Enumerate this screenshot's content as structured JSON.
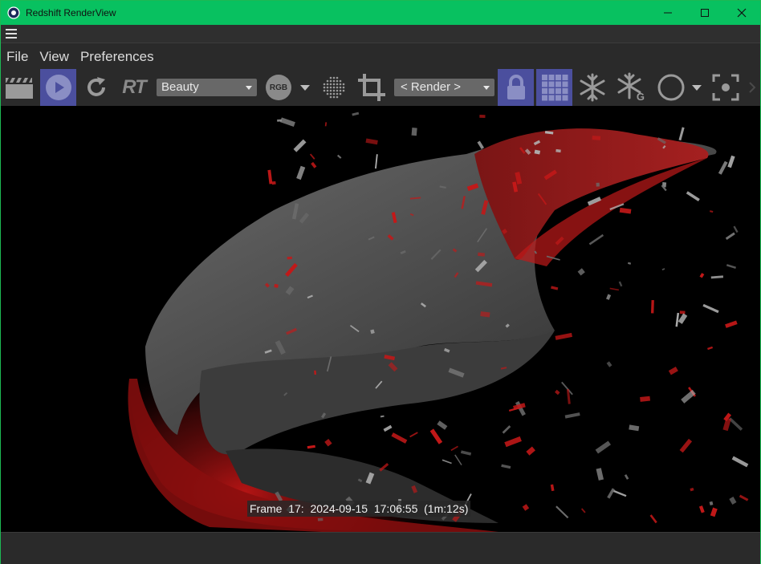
{
  "window": {
    "title": "Redshift RenderView",
    "minimize_glyph": "—",
    "maximize_glyph": "☐",
    "close_glyph": "✕"
  },
  "menu": [
    "File",
    "View",
    "Preferences"
  ],
  "toolbar": {
    "aov_dropdown": "Beauty",
    "rgb_label": "RGB",
    "rt_label": "RT",
    "camera_dropdown": "< Render >",
    "freeze_g_label": "G"
  },
  "viewport": {
    "frame_info": "Frame  17:  2024-09-15  17:06:55  (1m:12s)"
  },
  "colors": {
    "titlebar": "#08c160",
    "active_button": "#4b4f9e",
    "icon": "#9a9a9a",
    "render_red": "#d01818"
  }
}
